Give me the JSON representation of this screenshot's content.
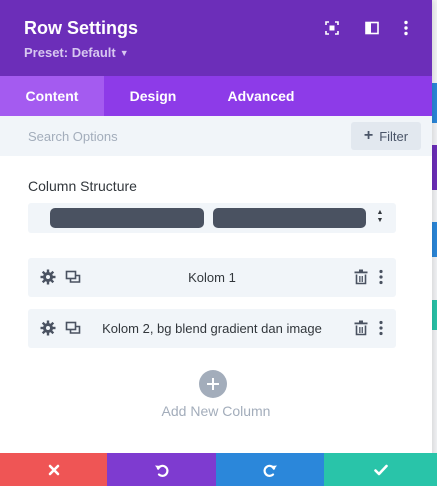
{
  "colors": {
    "header": "#6c2eb9",
    "tabs": "#8d3be8",
    "tab_active": "#a45bf0",
    "discard": "#ef5555",
    "undo": "#7e3bd0",
    "redo": "#2b87da",
    "save": "#29c4a9"
  },
  "header": {
    "title": "Row Settings",
    "preset": "Preset: Default",
    "icons": [
      "screenshot-icon",
      "sidebar-toggle-icon",
      "more-vertical-icon"
    ]
  },
  "tabs": [
    {
      "label": "Content",
      "active": true
    },
    {
      "label": "Design",
      "active": false
    },
    {
      "label": "Advanced",
      "active": false
    }
  ],
  "search": {
    "placeholder": "Search Options",
    "filter_label": "Filter"
  },
  "column_structure": {
    "label": "Column Structure",
    "columns": 2
  },
  "columns": [
    {
      "label": "Kolom 1"
    },
    {
      "label": "Kolom 2, bg blend gradient dan image"
    }
  ],
  "add_column": {
    "label": "Add New Column"
  },
  "footer": {
    "buttons": [
      "discard-icon",
      "undo-icon",
      "redo-icon",
      "save-icon"
    ]
  }
}
